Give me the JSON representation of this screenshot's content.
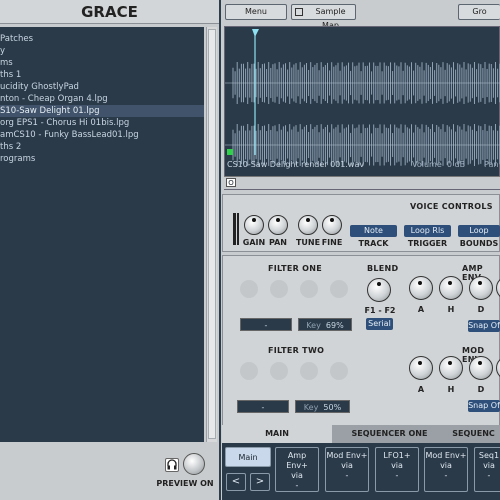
{
  "app": {
    "title": "GRACE"
  },
  "browser": {
    "items": [
      {
        "label": "Patches",
        "selected": false
      },
      {
        "label": "y",
        "selected": false
      },
      {
        "label": "ms",
        "selected": false
      },
      {
        "label": "ths 1",
        "selected": false
      },
      {
        "label": "ucidity GhostlyPad",
        "selected": false
      },
      {
        "label": "nton - Cheap Organ 4.lpg",
        "selected": false
      },
      {
        "label": "S10-Saw Delight 01.lpg",
        "selected": true
      },
      {
        "label": "org EPS1 - Chorus Hi 01bis.lpg",
        "selected": false
      },
      {
        "label": "amCS10 - Funky BassLead01.lpg",
        "selected": false
      },
      {
        "label": "ths 2",
        "selected": false
      },
      {
        "label": "rograms",
        "selected": false
      }
    ],
    "preview_label": "PREVIEW ON"
  },
  "toolbar": {
    "menu_label": "Menu",
    "sample_map_label": "Sample Map",
    "group_label": "Gro"
  },
  "sample": {
    "file": "CS10-Saw Delight render 001.wav",
    "volume_label": "Volume",
    "volume_value": "0 dB",
    "pan_label": "Pan"
  },
  "voice": {
    "title": "VOICE CONTROLS",
    "knobs": [
      "GAIN",
      "PAN",
      "TUNE",
      "FINE"
    ],
    "track_value": "Note",
    "track_label": "TRACK",
    "trigger_value": "Loop Rls",
    "trigger_label": "TRIGGER",
    "bounds_value": "Loop",
    "bounds_label": "BOUNDS"
  },
  "filter_one": {
    "title": "FILTER ONE",
    "type_value": "-",
    "key_label": "Key",
    "key_value": "69%"
  },
  "filter_two": {
    "title": "FILTER TWO",
    "type_value": "-",
    "key_label": "Key",
    "key_value": "50%"
  },
  "blend": {
    "title": "BLEND",
    "knob_label": "F1 - F2",
    "mode": "Serial"
  },
  "amp_env": {
    "title": "AMP ENV",
    "knobs": [
      "A",
      "H",
      "D"
    ],
    "snap": "Snap Of"
  },
  "mod_env": {
    "title": "MOD ENV",
    "knobs": [
      "A",
      "H",
      "D"
    ],
    "snap": "Snap Of"
  },
  "tabs": [
    "MAIN",
    "SEQUENCER ONE",
    "SEQUENC"
  ],
  "mod_slots": [
    {
      "label": "Main",
      "sub": "",
      "active": true
    },
    {
      "label": "Amp Env+",
      "sub": "via",
      "active": false
    },
    {
      "label": "Mod Env+",
      "sub": "via",
      "active": false
    },
    {
      "label": "LFO1+",
      "sub": "via",
      "active": false
    },
    {
      "label": "Mod Env+",
      "sub": "via",
      "active": false
    },
    {
      "label": "Seq1",
      "sub": "via",
      "active": false
    }
  ],
  "nav": {
    "prev": "<",
    "next": ">"
  },
  "colors": {
    "panel": "#c9ccce",
    "dark": "#2b3a49",
    "accent": "#2d4f7a",
    "waveform": "#8fa3b5",
    "marker": "#8fe0f0"
  }
}
